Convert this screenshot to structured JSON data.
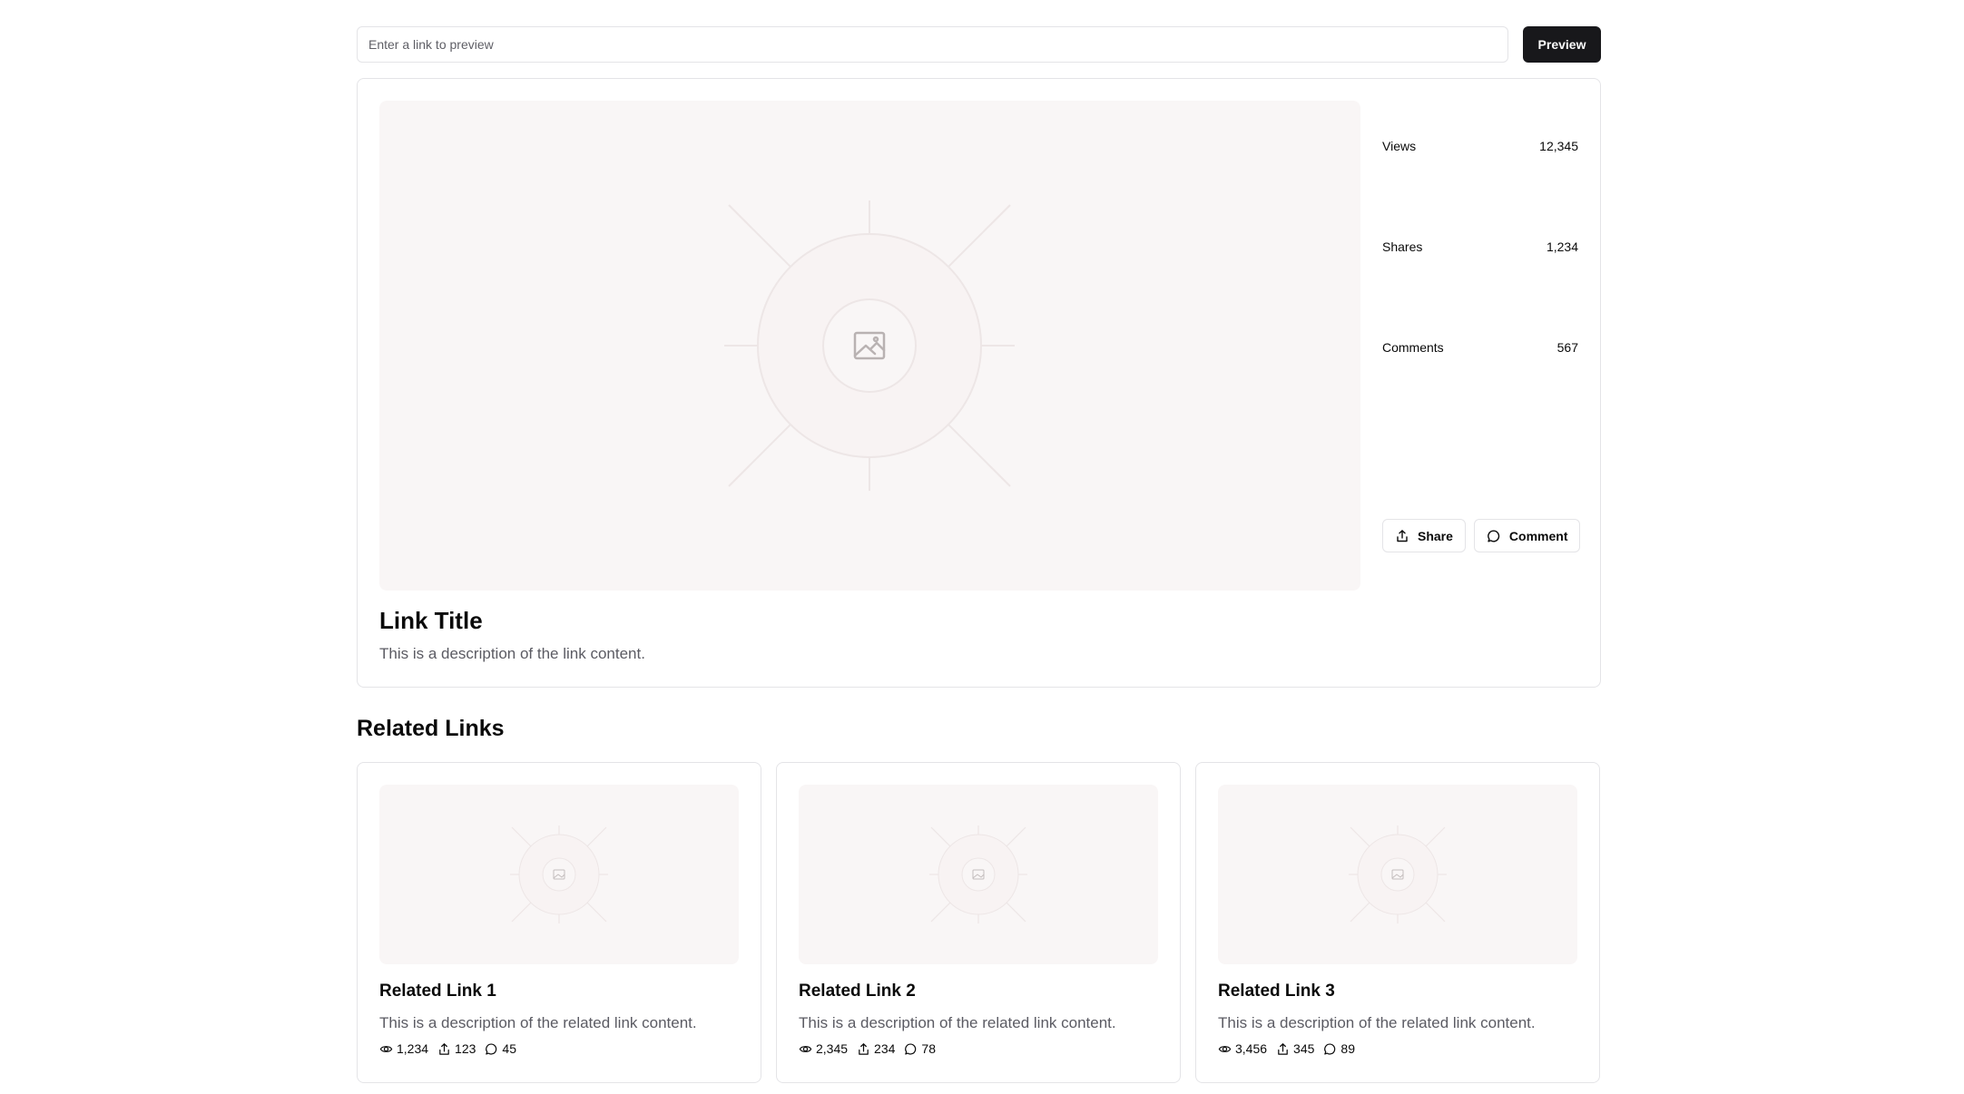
{
  "search": {
    "placeholder": "Enter a link to preview",
    "value": "",
    "button_label": "Preview"
  },
  "main": {
    "image_icon": "image-placeholder-icon",
    "title": "Link Title",
    "description": "This is a description of the link content.",
    "stats": [
      {
        "label": "Views",
        "value": "12,345"
      },
      {
        "label": "Shares",
        "value": "1,234"
      },
      {
        "label": "Comments",
        "value": "567"
      }
    ],
    "actions": [
      {
        "label": "Share",
        "icon": "share-icon"
      },
      {
        "label": "Comment",
        "icon": "comment-icon"
      }
    ]
  },
  "related": {
    "heading": "Related Links",
    "items": [
      {
        "title": "Related Link 1",
        "description": "This is a description of the related link content.",
        "views": "1,234",
        "shares": "123",
        "comments": "45"
      },
      {
        "title": "Related Link 2",
        "description": "This is a description of the related link content.",
        "views": "2,345",
        "shares": "234",
        "comments": "78"
      },
      {
        "title": "Related Link 3",
        "description": "This is a description of the related link content.",
        "views": "3,456",
        "shares": "345",
        "comments": "89"
      }
    ]
  },
  "colors": {
    "primary_button": "#18181b",
    "border": "#e4e4e7",
    "muted_text": "#5b5b63",
    "placeholder_bg": "#f9f6f6"
  }
}
